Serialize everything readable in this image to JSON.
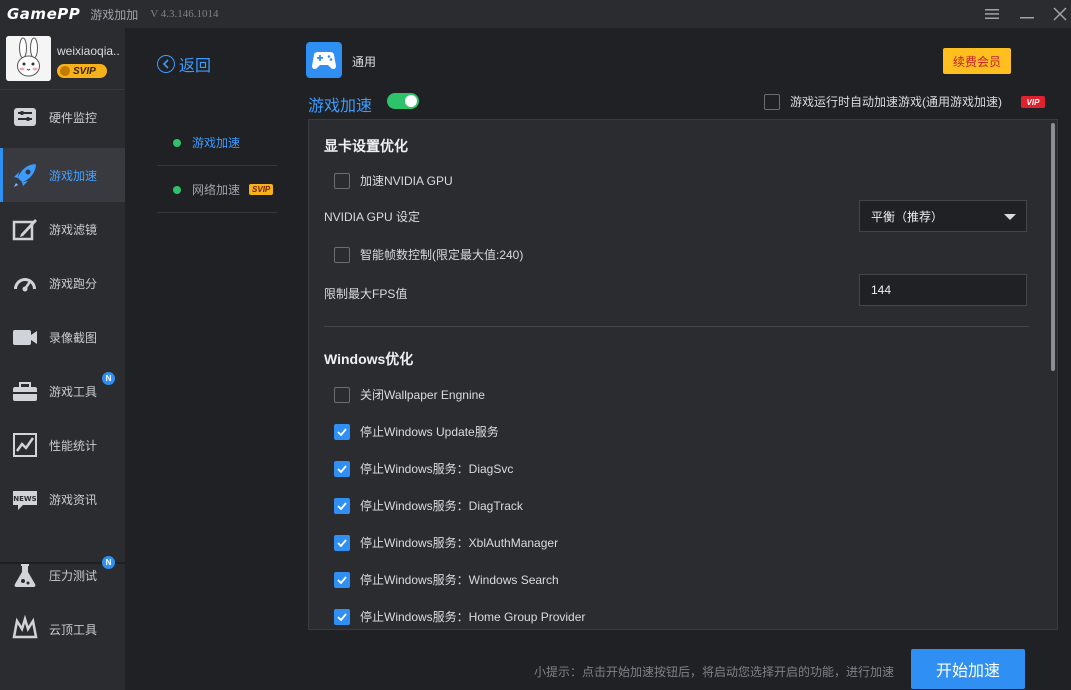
{
  "titlebar": {
    "logo": "GamePP",
    "app_name": "游戏加加",
    "version": "V 4.3.146.1014"
  },
  "user": {
    "name": "weixiaoqia..",
    "badge": "SVIP"
  },
  "sidebar": {
    "items": [
      {
        "label": "硬件监控",
        "icon": "hardware-monitor-icon"
      },
      {
        "label": "游戏加速",
        "icon": "rocket-icon"
      },
      {
        "label": "游戏滤镜",
        "icon": "filter-icon"
      },
      {
        "label": "游戏跑分",
        "icon": "speedometer-icon"
      },
      {
        "label": "录像截图",
        "icon": "camera-icon"
      },
      {
        "label": "游戏工具",
        "icon": "toolbox-icon",
        "badge": "N"
      },
      {
        "label": "性能统计",
        "icon": "chart-icon"
      },
      {
        "label": "游戏资讯",
        "icon": "news-icon",
        "icon_text": "NEWS"
      },
      {
        "label": "压力测试",
        "icon": "flask-icon",
        "badge": "N"
      },
      {
        "label": "云顶工具",
        "icon": "crown-icon"
      }
    ]
  },
  "subnav": {
    "back": "返回",
    "items": [
      {
        "label": "游戏加速"
      },
      {
        "label": "网络加速",
        "badge": "SVIP"
      }
    ]
  },
  "header": {
    "category": "通用",
    "renew_button": "续费会员",
    "section_title": "游戏加速",
    "auto_accel_label": "游戏运行时自动加速游戏(通用游戏加速)",
    "vip_tag": "VIP"
  },
  "gpu": {
    "title": "显卡设置优化",
    "accel_nvidia": "加速NVIDIA GPU",
    "nvidia_setting_label": "NVIDIA GPU 设定",
    "nvidia_setting_value": "平衡（推荐）",
    "smart_fps": "智能帧数控制(限定最大值:240)",
    "max_fps_label": "限制最大FPS值",
    "max_fps_value": "144"
  },
  "windows": {
    "title": "Windows优化",
    "options": [
      {
        "label": "关闭Wallpaper Engnine",
        "checked": false
      },
      {
        "label": "停止Windows Update服务",
        "checked": true
      },
      {
        "label": "停止Windows服务：DiagSvc",
        "checked": true
      },
      {
        "label": "停止Windows服务：DiagTrack",
        "checked": true
      },
      {
        "label": "停止Windows服务：XblAuthManager",
        "checked": true
      },
      {
        "label": "停止Windows服务：Windows Search",
        "checked": true
      },
      {
        "label": "停止Windows服务：Home Group Provider",
        "checked": true
      }
    ]
  },
  "footer": {
    "tip": "小提示：点击开始加速按钮后，将启动您选择开启的功能，进行加速",
    "start_button": "开始加速"
  },
  "colors": {
    "accent": "#2f8ff3",
    "toggle_on": "#2ec26a",
    "renew_bg": "#ffbf1f",
    "vip_red": "#e0222f"
  }
}
